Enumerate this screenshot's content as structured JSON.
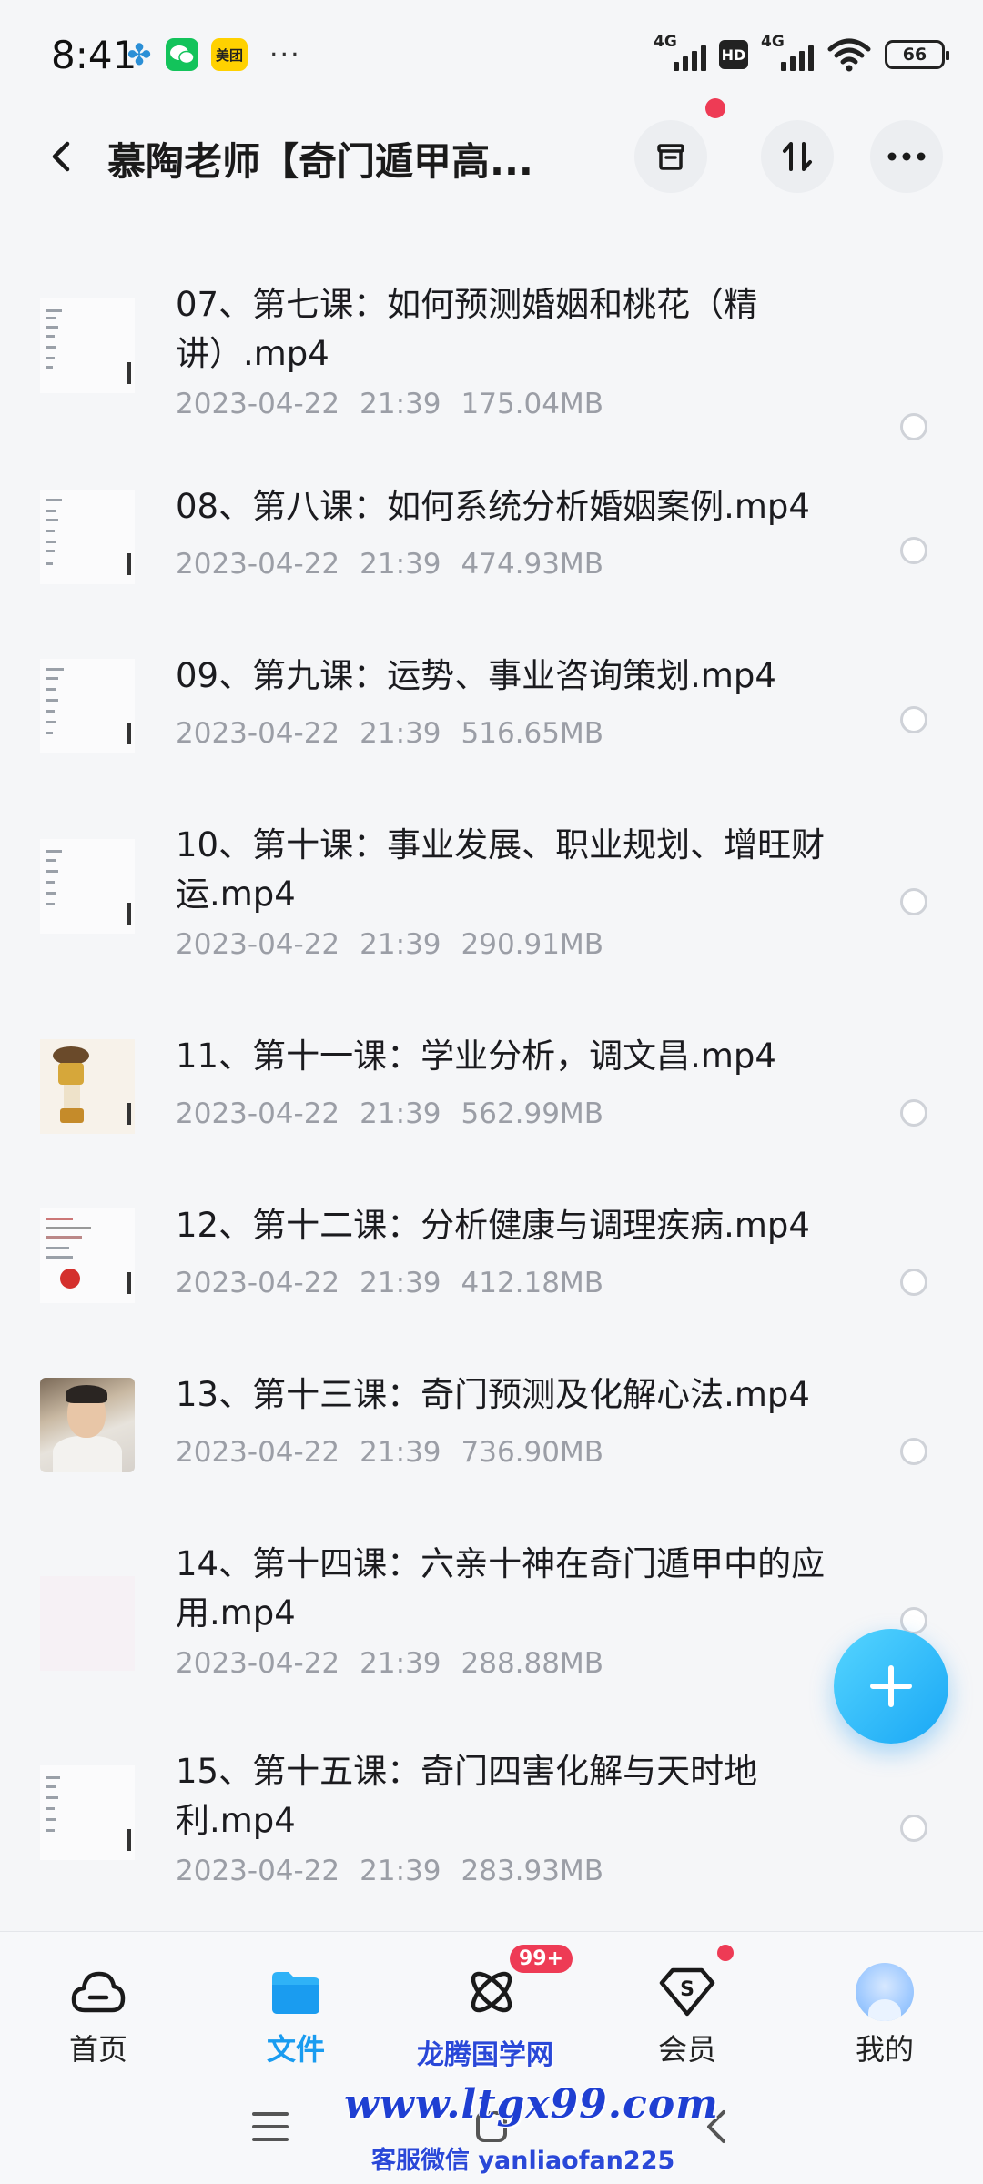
{
  "status_bar": {
    "time": "8:41",
    "apps": [
      "clover-icon",
      "wechat-icon",
      "meituan-icon"
    ],
    "meituan_label": "美团",
    "more_dots": "···",
    "network_1": "4G",
    "hd": "HD",
    "network_2": "4G",
    "battery": "66"
  },
  "header": {
    "title": "慕陶老师【奇门遁甲高...",
    "icons": [
      "back-icon",
      "archive-icon",
      "sort-icon",
      "more-icon"
    ]
  },
  "files": [
    {
      "name": "07、第七课：如何预测婚姻和桃花（精讲）.mp4",
      "date": "2023-04-22",
      "time": "21:39",
      "size": "175.04MB"
    },
    {
      "name": "08、第八课：如何系统分析婚姻案例.mp4",
      "date": "2023-04-22",
      "time": "21:39",
      "size": "474.93MB"
    },
    {
      "name": "09、第九课：运势、事业咨询策划.mp4",
      "date": "2023-04-22",
      "time": "21:39",
      "size": "516.65MB"
    },
    {
      "name": "10、第十课：事业发展、职业规划、增旺财运.mp4",
      "date": "2023-04-22",
      "time": "21:39",
      "size": "290.91MB"
    },
    {
      "name": "11、第十一课：学业分析，调文昌.mp4",
      "date": "2023-04-22",
      "time": "21:39",
      "size": "562.99MB"
    },
    {
      "name": "12、第十二课：分析健康与调理疾病.mp4",
      "date": "2023-04-22",
      "time": "21:39",
      "size": "412.18MB"
    },
    {
      "name": "13、第十三课：奇门预测及化解心法.mp4",
      "date": "2023-04-22",
      "time": "21:39",
      "size": "736.90MB"
    },
    {
      "name": "14、第十四课：六亲十神在奇门遁甲中的应用.mp4",
      "date": "2023-04-22",
      "time": "21:39",
      "size": "288.88MB"
    },
    {
      "name": "15、第十五课：奇门四害化解与天时地利.mp4",
      "date": "2023-04-22",
      "time": "21:39",
      "size": "283.93MB"
    }
  ],
  "bottom_nav": {
    "items": [
      {
        "label": "首页",
        "icon": "cloud-home-icon"
      },
      {
        "label": "文件",
        "icon": "folder-icon"
      },
      {
        "label": "",
        "icon": "atom-icon"
      },
      {
        "label": "会员",
        "icon": "vip-shield-icon"
      },
      {
        "label": "我的",
        "icon": "avatar"
      }
    ],
    "badge": "99+"
  },
  "watermark": {
    "brand": "龙腾国学网",
    "site": "www.ltgx99.com",
    "wechat": "客服微信 yanliaofan225"
  },
  "colors": {
    "accent": "#1a9cf0",
    "badge": "#ee3b55",
    "watermark": "#1f3fd2"
  }
}
